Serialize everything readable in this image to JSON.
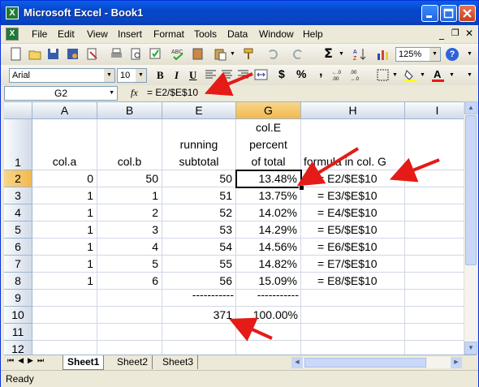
{
  "window": {
    "title": "Microsoft Excel - Book1"
  },
  "menu": [
    "File",
    "Edit",
    "View",
    "Insert",
    "Format",
    "Tools",
    "Data",
    "Window",
    "Help"
  ],
  "help_icon_label": "?",
  "toolbar": {
    "zoom": "125%",
    "font_name": "Arial",
    "font_size": "10",
    "bold": "B",
    "italic": "I",
    "underline": "U",
    "currency": "$",
    "percent": "%",
    "comma": ",",
    "sum": "Σ"
  },
  "formula_bar": {
    "cell_ref": "G2",
    "fx": "fx",
    "formula": "=  E2/$E$10"
  },
  "columns": [
    "A",
    "B",
    "E",
    "G",
    "H",
    "I"
  ],
  "rows": [
    "1",
    "2",
    "3",
    "4",
    "5",
    "6",
    "7",
    "8",
    "9",
    "10",
    "11",
    "12"
  ],
  "headers": {
    "a": "col.a",
    "b": "col.b",
    "e": [
      "running",
      "subtotal"
    ],
    "g": [
      "col.E",
      "percent",
      "of total"
    ],
    "h": "formula in col. G"
  },
  "data": [
    {
      "a": "0",
      "b": "50",
      "e": "50",
      "g": "13.48%",
      "h": "=   E2/$E$10"
    },
    {
      "a": "1",
      "b": "1",
      "e": "51",
      "g": "13.75%",
      "h": "=   E3/$E$10"
    },
    {
      "a": "1",
      "b": "2",
      "e": "52",
      "g": "14.02%",
      "h": "=   E4/$E$10"
    },
    {
      "a": "1",
      "b": "3",
      "e": "53",
      "g": "14.29%",
      "h": "=   E5/$E$10"
    },
    {
      "a": "1",
      "b": "4",
      "e": "54",
      "g": "14.56%",
      "h": "=   E6/$E$10"
    },
    {
      "a": "1",
      "b": "5",
      "e": "55",
      "g": "14.82%",
      "h": "=   E7/$E$10"
    },
    {
      "a": "1",
      "b": "6",
      "e": "56",
      "g": "15.09%",
      "h": "=   E8/$E$10"
    }
  ],
  "separator": {
    "e": "-----------",
    "g": "-----------"
  },
  "totals": {
    "e": "371",
    "g": "100.00%"
  },
  "sheets": [
    "Sheet1",
    "Sheet2",
    "Sheet3"
  ],
  "status": "Ready",
  "colors": {
    "title_bar": "#0A4FD9",
    "arrow": "#E41B17",
    "selected_header": "#F1B94E"
  }
}
